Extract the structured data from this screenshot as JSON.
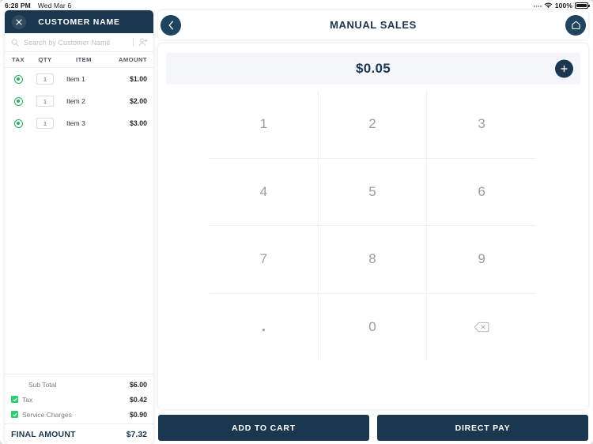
{
  "status_bar": {
    "time": "6:28 PM",
    "date": "Wed Mar 6",
    "battery_percent": "100%",
    "wifi_icon": "wifi-icon",
    "battery_icon": "battery-icon"
  },
  "sidebar": {
    "close_icon": "close-icon",
    "title": "CUSTOMER NAME",
    "search": {
      "icon": "search-icon",
      "placeholder": "Search by Customer Name",
      "add_customer_icon": "add-person-icon"
    },
    "columns": {
      "tax": "TAX",
      "qty": "QTY",
      "item": "ITEM",
      "amount": "AMOUNT"
    },
    "rows": [
      {
        "qty": "1",
        "item": "Item 1",
        "amount": "$1.00",
        "tax_selected": true
      },
      {
        "qty": "1",
        "item": "Item 2",
        "amount": "$2.00",
        "tax_selected": true
      },
      {
        "qty": "1",
        "item": "Item 3",
        "amount": "$3.00",
        "tax_selected": true
      }
    ],
    "totals": {
      "sub_total_label": "Sub Total",
      "sub_total_value": "$6.00",
      "tax_label": "Tax",
      "tax_value": "$0.42",
      "tax_checked": true,
      "service_label": "Service Charges",
      "service_value": "$0.90",
      "service_checked": true,
      "final_label": "FINAL AMOUNT",
      "final_value": "$7.32"
    }
  },
  "main": {
    "back_icon": "chevron-left-icon",
    "title": "MANUAL SALES",
    "home_icon": "home-icon",
    "amount_display": "$0.05",
    "add_icon": "plus-icon",
    "keypad": [
      {
        "label": "1",
        "name": "key-1"
      },
      {
        "label": "2",
        "name": "key-2"
      },
      {
        "label": "3",
        "name": "key-3"
      },
      {
        "label": "4",
        "name": "key-4"
      },
      {
        "label": "5",
        "name": "key-5"
      },
      {
        "label": "6",
        "name": "key-6"
      },
      {
        "label": "7",
        "name": "key-7"
      },
      {
        "label": "8",
        "name": "key-8"
      },
      {
        "label": "9",
        "name": "key-9"
      },
      {
        "label": ".",
        "name": "key-decimal"
      },
      {
        "label": "0",
        "name": "key-0"
      },
      {
        "label": "",
        "name": "key-backspace"
      }
    ],
    "actions": {
      "add_to_cart": "ADD  TO CART",
      "direct_pay": "DIRECT PAY"
    }
  },
  "colors": {
    "navy": "#1b3750",
    "navy_light": "#1f4460",
    "green": "#27ae5f",
    "green_check": "#2ecc71",
    "amount_bar_bg": "#f4f6fa",
    "key_text": "#9a9da3"
  }
}
